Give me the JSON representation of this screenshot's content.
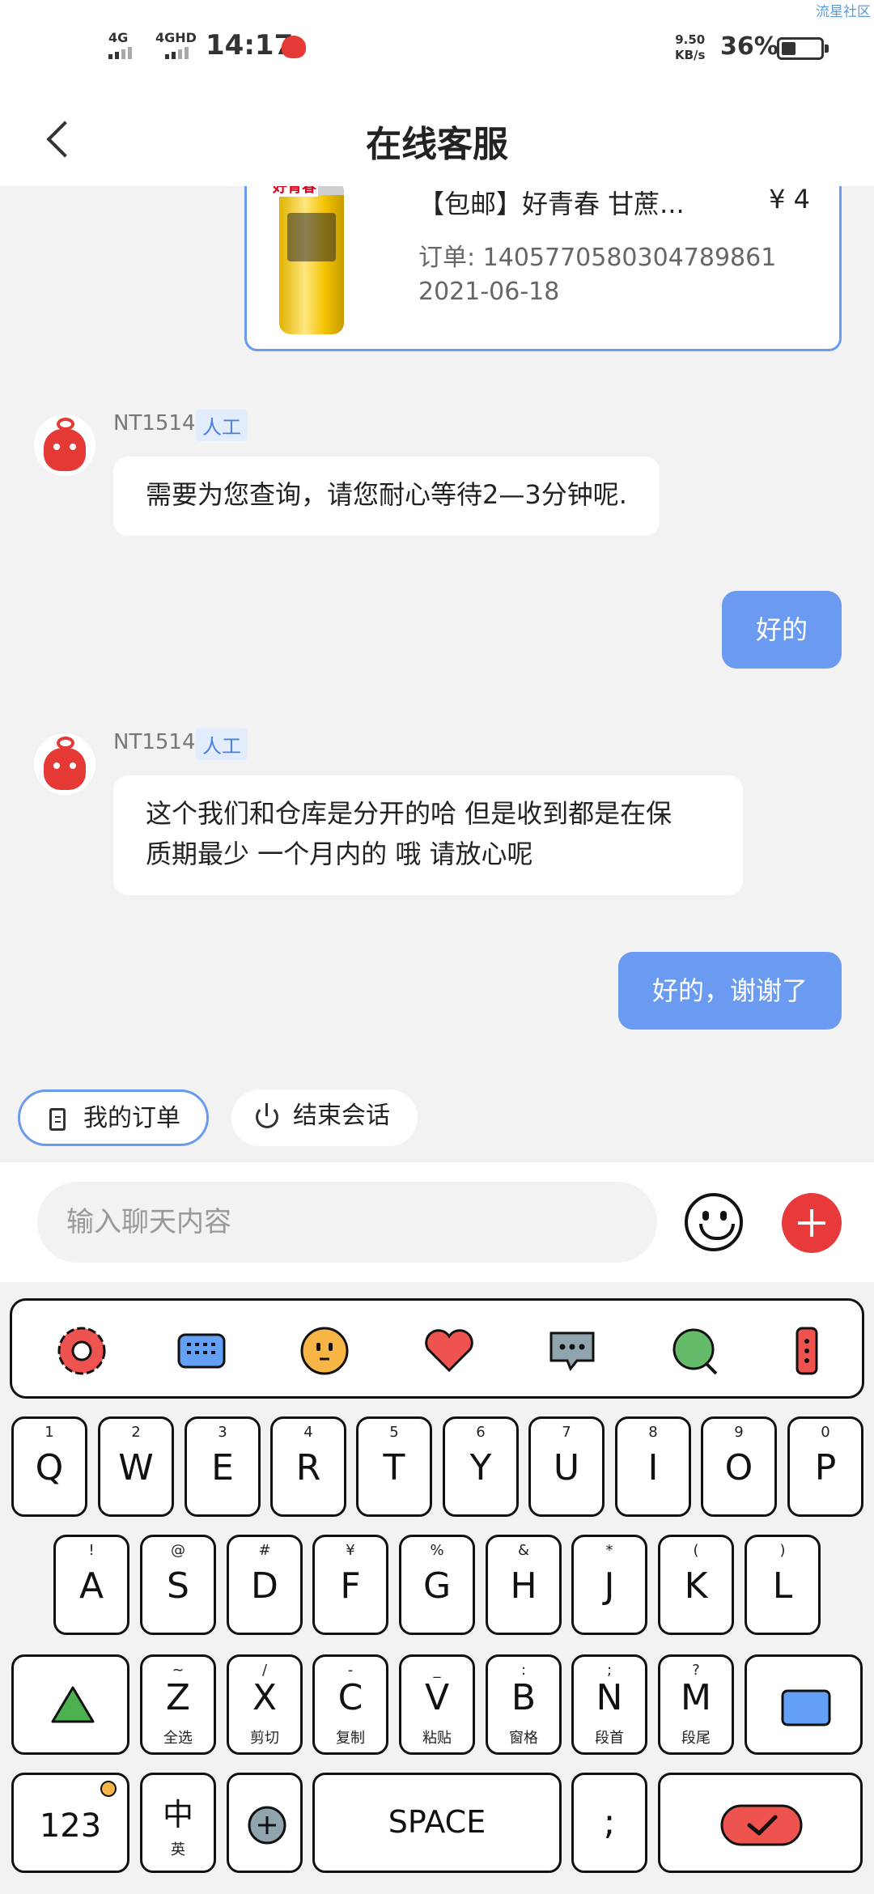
{
  "status_bar": {
    "network1": "4G",
    "network2": "4GHD",
    "time": "14:17",
    "speed_value": "9.50",
    "speed_unit": "KB/s",
    "battery_percent": "36%",
    "battery_level": 0.36,
    "watermark": "流星社区"
  },
  "header": {
    "title": "在线客服"
  },
  "order_card": {
    "brand": "好青春",
    "title": "【包邮】好青春 甘蔗...",
    "price": "¥ 4",
    "order_no": "订单: 1405770580304789861",
    "date": "2021-06-18"
  },
  "messages": [
    {
      "side": "in",
      "agent": "NT1514",
      "tag": "人工",
      "text": "需要为您查询，请您耐心等待2—3分钟呢."
    },
    {
      "side": "out",
      "text": "好的"
    },
    {
      "side": "in",
      "agent": "NT1514",
      "tag": "人工",
      "line1": "这个我们和仓库是分开的哈 但是收到都是在保",
      "line2": "质期最少 一个月内的 哦 请放心呢"
    },
    {
      "side": "out",
      "text": "好的，谢谢了"
    }
  ],
  "quick_actions": {
    "my_orders": "我的订单",
    "end_chat": "结束会话"
  },
  "input": {
    "placeholder": "输入聊天内容"
  },
  "keyboard": {
    "toolbar_icons": [
      "settings-icon",
      "keyboard-icon",
      "emoji-face-icon",
      "heart-icon",
      "chat-bubble-icon",
      "search-icon",
      "more-icon"
    ],
    "row1": [
      {
        "main": "Q",
        "sub": "1"
      },
      {
        "main": "W",
        "sub": "2"
      },
      {
        "main": "E",
        "sub": "3"
      },
      {
        "main": "R",
        "sub": "4"
      },
      {
        "main": "T",
        "sub": "5"
      },
      {
        "main": "Y",
        "sub": "6"
      },
      {
        "main": "U",
        "sub": "7"
      },
      {
        "main": "I",
        "sub": "8"
      },
      {
        "main": "O",
        "sub": "9"
      },
      {
        "main": "P",
        "sub": "0"
      }
    ],
    "row2": [
      {
        "main": "A",
        "sub": "!"
      },
      {
        "main": "S",
        "sub": "@"
      },
      {
        "main": "D",
        "sub": "#"
      },
      {
        "main": "F",
        "sub": "¥"
      },
      {
        "main": "G",
        "sub": "%"
      },
      {
        "main": "H",
        "sub": "&"
      },
      {
        "main": "J",
        "sub": "*"
      },
      {
        "main": "K",
        "sub": "("
      },
      {
        "main": "L",
        "sub": ")"
      }
    ],
    "row3": [
      {
        "main": "Z",
        "sub": "~",
        "cap": "全选"
      },
      {
        "main": "X",
        "sub": "/",
        "cap": "剪切"
      },
      {
        "main": "C",
        "sub": "-",
        "cap": "复制"
      },
      {
        "main": "V",
        "sub": "_",
        "cap": "粘贴"
      },
      {
        "main": "B",
        "sub": ":",
        "cap": "窗格"
      },
      {
        "main": "N",
        "sub": ";",
        "cap": "段首"
      },
      {
        "main": "M",
        "sub": "?",
        "cap": "段尾"
      }
    ],
    "num_label": "123",
    "lang_main": "中",
    "lang_sub": "英",
    "space": "SPACE",
    "punct": ";"
  }
}
